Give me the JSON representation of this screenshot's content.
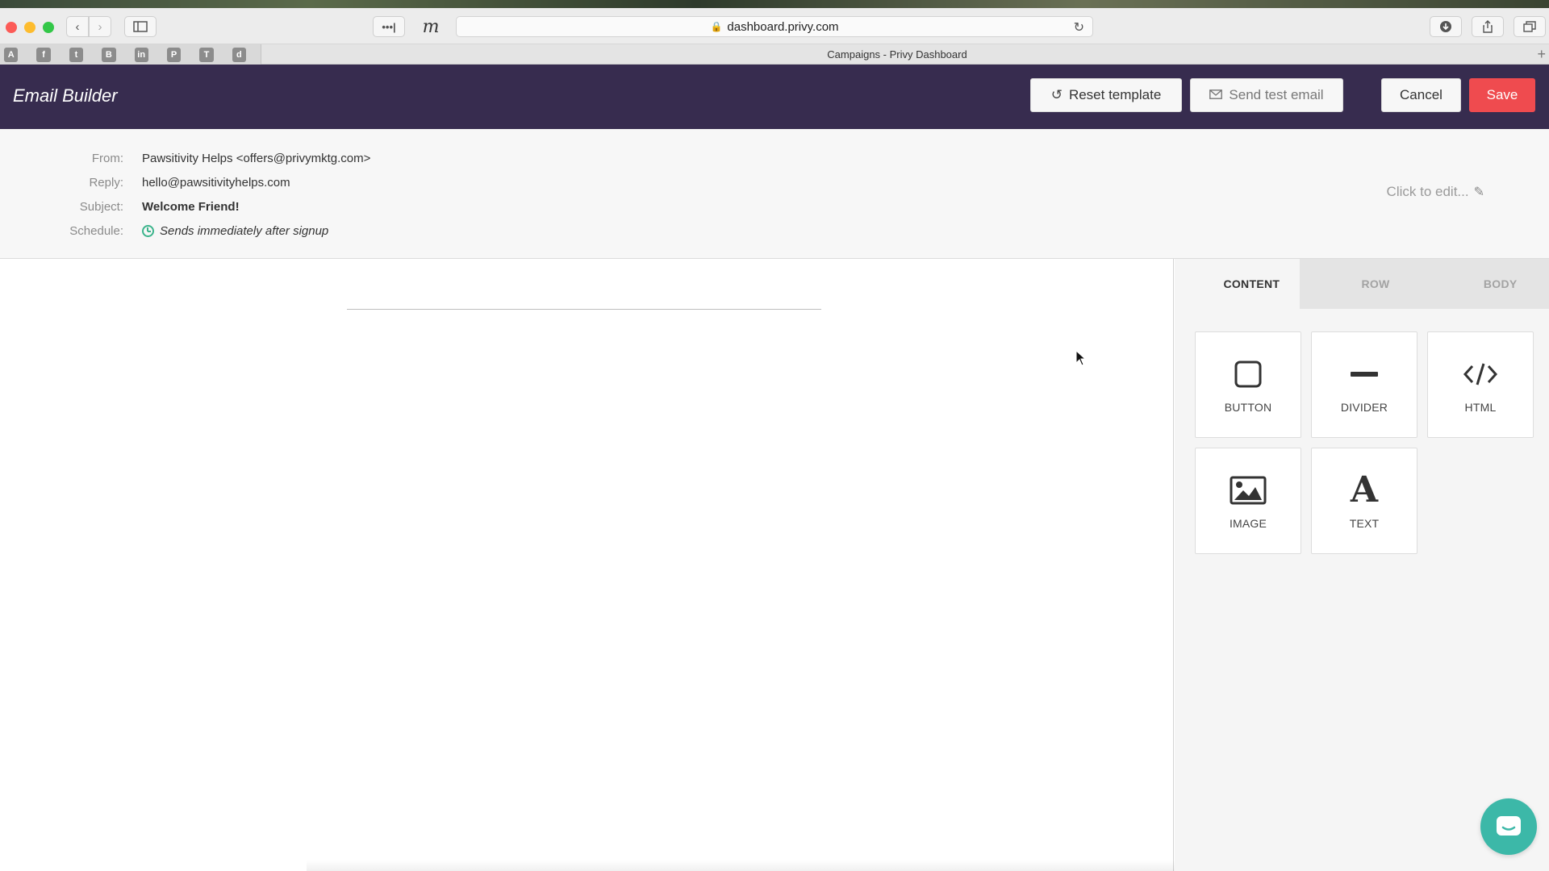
{
  "browser": {
    "address": "dashboard.privy.com",
    "tab_title": "Campaigns - Privy Dashboard",
    "bookmarks": [
      "A",
      "f",
      "t",
      "B",
      "in",
      "P",
      "T",
      "d"
    ]
  },
  "header": {
    "title": "Email Builder",
    "reset_label": "Reset template",
    "send_test_label": "Send test email",
    "cancel_label": "Cancel",
    "save_label": "Save",
    "save_color": "#ef4b4f",
    "bg_color": "#372c4f"
  },
  "meta": {
    "from_label": "From:",
    "from_value": "Pawsitivity Helps <offers@privymktg.com>",
    "reply_label": "Reply:",
    "reply_value": "hello@pawsitivityhelps.com",
    "subject_label": "Subject:",
    "subject_value": "Welcome Friend!",
    "schedule_label": "Schedule:",
    "schedule_value": "Sends immediately after signup",
    "edit_hint": "Click to edit..."
  },
  "sidebar": {
    "tabs": [
      {
        "label": "CONTENT",
        "icon": "grid-icon",
        "active": true
      },
      {
        "label": "ROW",
        "icon": "lines-icon",
        "active": false
      },
      {
        "label": "BODY",
        "icon": "lines-icon",
        "active": false
      }
    ],
    "blocks": [
      {
        "label": "BUTTON",
        "icon": "button-square-icon"
      },
      {
        "label": "DIVIDER",
        "icon": "divider-icon"
      },
      {
        "label": "HTML",
        "icon": "code-icon"
      },
      {
        "label": "IMAGE",
        "icon": "image-icon"
      },
      {
        "label": "TEXT",
        "icon": "text-icon"
      }
    ]
  },
  "chat": {
    "icon": "chat-icon",
    "color": "#3cb8a8"
  }
}
